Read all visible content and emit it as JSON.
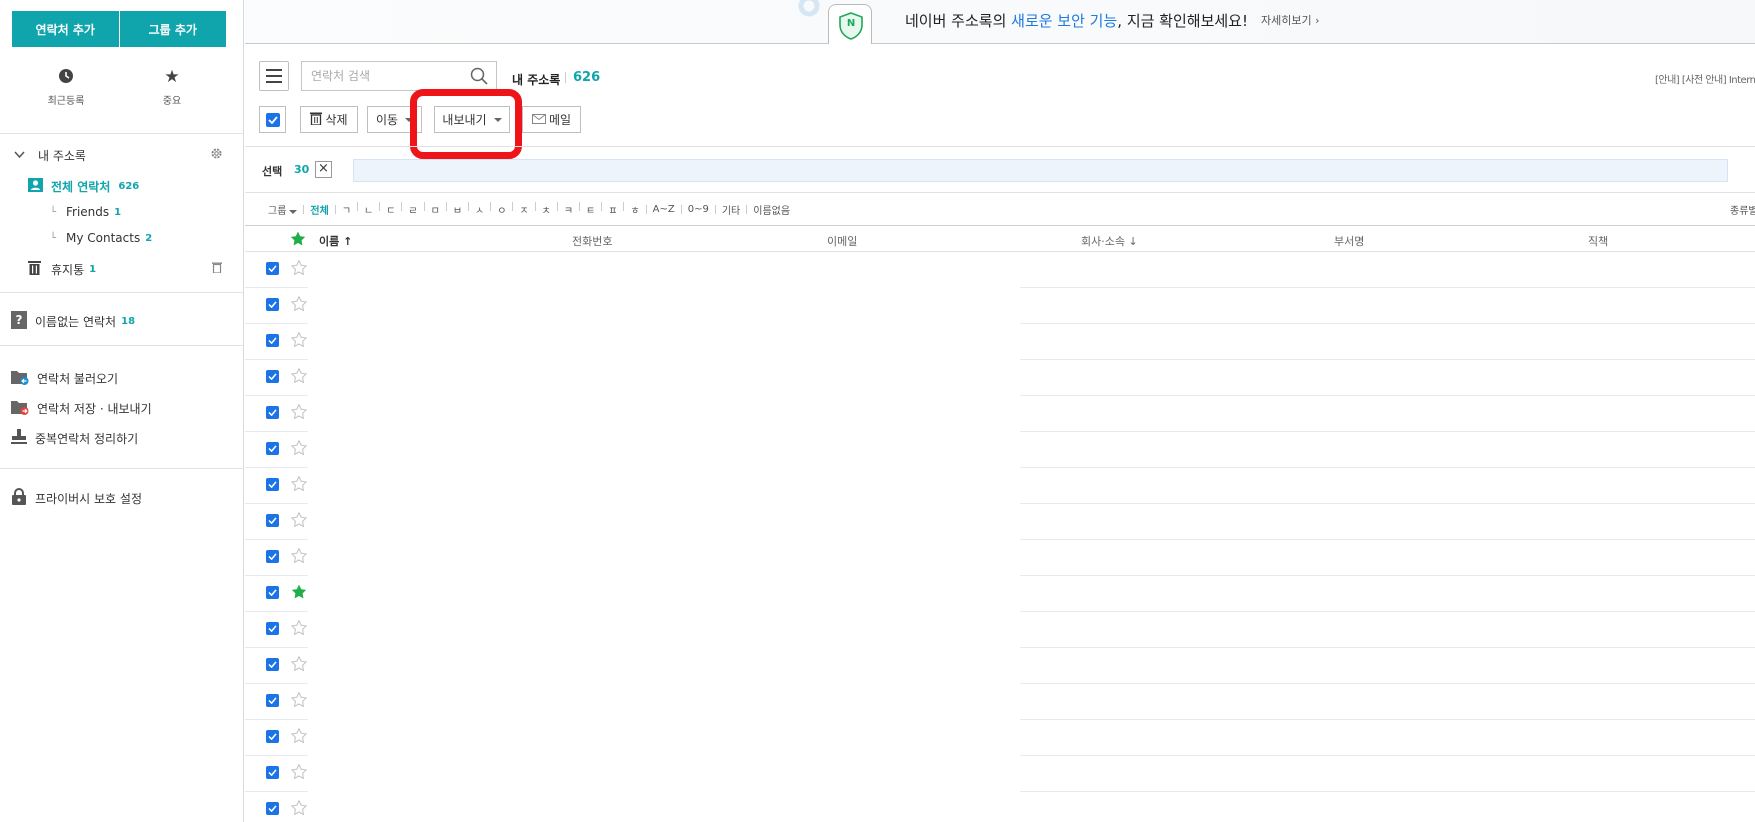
{
  "sidebar": {
    "add_contact": "연락처 추가",
    "add_group": "그룹 추가",
    "recent_label": "최근등록",
    "favorite_label": "중요",
    "my_address_book": "내 주소록",
    "all_contacts": "전체 연락처",
    "all_contacts_count": "626",
    "groups": [
      {
        "name": "Friends",
        "count": "1"
      },
      {
        "name": "My Contacts",
        "count": "2"
      }
    ],
    "trash": "휴지통",
    "trash_count": "1",
    "unnamed": "이름없는 연락처",
    "unnamed_count": "18",
    "import": "연락처 불러오기",
    "export": "연락처 저장 · 내보내기",
    "dedupe": "중복연락처 정리하기",
    "privacy": "프라이버시 보호 설정"
  },
  "banner": {
    "text_before": "네이버 주소록의 ",
    "text_highlight": "새로운 보안 기능",
    "text_after": ", 지금 확인해보세요!",
    "more": "자세히보기 ›",
    "badge_letter": "N"
  },
  "toolbar": {
    "search_placeholder": "연락처 검색",
    "title": "내 주소록",
    "count": "626",
    "notice": "[안내] [사전 안내] Internet",
    "delete": "삭제",
    "move": "이동",
    "export": "내보내기",
    "mail": "메일"
  },
  "selection": {
    "label": "선택",
    "count": "30",
    "close": "×"
  },
  "filter": {
    "group": "그룹",
    "all": "전체",
    "letters": [
      "ㄱ",
      "ㄴ",
      "ㄷ",
      "ㄹ",
      "ㅁ",
      "ㅂ",
      "ㅅ",
      "ㅇ",
      "ㅈ",
      "ㅊ",
      "ㅋ",
      "ㅌ",
      "ㅍ",
      "ㅎ"
    ],
    "az": "A~Z",
    "digits": "0~9",
    "other": "기타",
    "noname": "이름없음",
    "sort": "종류별"
  },
  "table": {
    "columns": {
      "name": "이름 ↑",
      "phone": "전화번호",
      "email": "이메일",
      "company": "회사·소속 ↓",
      "department": "부서명",
      "title": "직책"
    },
    "rows": [
      {
        "checked": true,
        "starred": false
      },
      {
        "checked": true,
        "starred": false
      },
      {
        "checked": true,
        "starred": false
      },
      {
        "checked": true,
        "starred": false
      },
      {
        "checked": true,
        "starred": false
      },
      {
        "checked": true,
        "starred": false
      },
      {
        "checked": true,
        "starred": false
      },
      {
        "checked": true,
        "starred": false
      },
      {
        "checked": true,
        "starred": false
      },
      {
        "checked": true,
        "starred": true
      },
      {
        "checked": true,
        "starred": false
      },
      {
        "checked": true,
        "starred": false
      },
      {
        "checked": true,
        "starred": false
      },
      {
        "checked": true,
        "starred": false
      },
      {
        "checked": true,
        "starred": false
      },
      {
        "checked": true,
        "starred": false
      }
    ]
  },
  "colors": {
    "accent": "#10a5ad",
    "checkbox": "#1a73e8",
    "star_on": "#1fae48",
    "highlight": "#ef1418"
  }
}
